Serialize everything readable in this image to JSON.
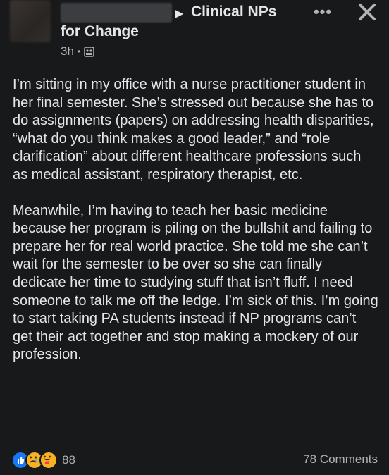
{
  "post": {
    "author_hidden": "",
    "group_line1": "Clinical NPs",
    "group_line2": "for Change",
    "time": "3h",
    "audience_icon": "group-audience-icon",
    "paragraphs": [
      "I’m sitting in my office with a nurse practitioner student in her final semester. She’s stressed out because she has to do assignments (papers) on addressing health disparities, “what do you think makes a good leader,” and “role clarification” about different healthcare professions such as medical assistant, respiratory therapist, etc.",
      "Meanwhile, I’m having to teach her basic medicine because her program is piling on the bullshit and failing to prepare her for real world practice. She told me she can’t wait for the semester to be over so she can finally dedicate her time to studying stuff that isn’t fluff. I need someone to talk me off the ledge. I’m sick of this. I’m going to start taking PA students instead if NP programs can’t get their act together and stop making a mockery of our profession."
    ],
    "reaction_count": "88",
    "comments_label": "78 Comments"
  },
  "icons": {
    "more": "more-options-icon",
    "close": "close-icon",
    "reactions": [
      "like-icon",
      "sad-icon",
      "care-icon"
    ]
  },
  "colors": {
    "background": "#18191a",
    "text": "#e4e6eb",
    "secondary": "#b0b3b8",
    "like_blue": "#1877f2",
    "emoji_yellow": "#f7b125"
  }
}
